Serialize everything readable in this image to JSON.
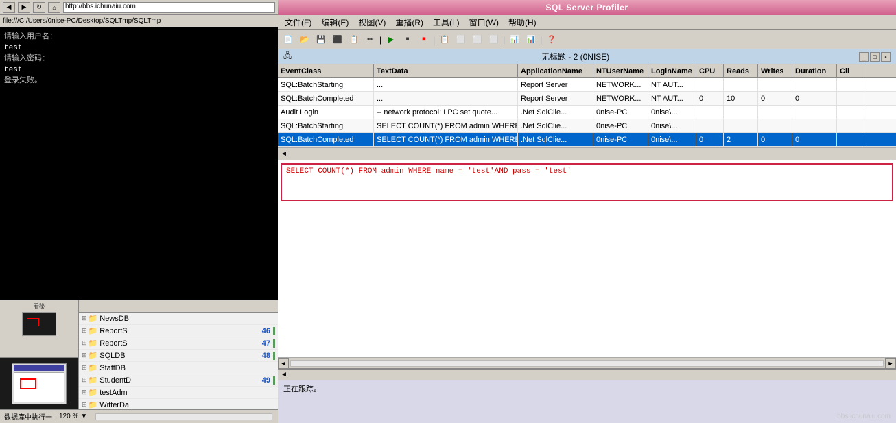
{
  "app": {
    "title": "SQL Server Profiler",
    "window_title": "无标题 - 2 (0NISE)"
  },
  "browser": {
    "url": "http://bbs.ichunaiu.com",
    "path": "file:///C:/Users/0nise-PC/Desktop/SQLTmp/SQLTmp",
    "back_btn": "◀",
    "forward_btn": "▶",
    "refresh_btn": "↻",
    "home_btn": "⌂"
  },
  "terminal": {
    "lines": [
      {
        "text": "请输入用户名：",
        "type": "prompt"
      },
      {
        "text": "test",
        "type": "input"
      },
      {
        "text": "请输入密码：",
        "type": "prompt"
      },
      {
        "text": "test",
        "type": "input"
      },
      {
        "text": "登录失败。",
        "type": "error"
      }
    ]
  },
  "menu": {
    "items": [
      {
        "label": "文件(F)"
      },
      {
        "label": "编辑(E)"
      },
      {
        "label": "视图(V)"
      },
      {
        "label": "重播(R)"
      },
      {
        "label": "工具(L)"
      },
      {
        "label": "窗口(W)"
      },
      {
        "label": "帮助(H)"
      }
    ]
  },
  "table": {
    "headers": [
      "EventClass",
      "TextData",
      "ApplicationName",
      "NTUserName",
      "LoginName",
      "CPU",
      "Reads",
      "Writes",
      "Duration",
      "Cli"
    ],
    "rows": [
      {
        "event": "SQL:BatchStarting",
        "textdata": "...",
        "appname": "Report Server",
        "ntuser": "NETWORK...",
        "login": "NT AUT...",
        "cpu": "",
        "reads": "",
        "writes": "",
        "duration": "",
        "cli": "",
        "selected": false
      },
      {
        "event": "SQL:BatchCompleted",
        "textdata": "...",
        "appname": "Report Server",
        "ntuser": "NETWORK...",
        "login": "NT AUT...",
        "cpu": "0",
        "reads": "10",
        "writes": "0",
        "duration": "0",
        "cli": "",
        "selected": false
      },
      {
        "event": "Audit Login",
        "textdata": "-- network protocol: LPC  set quote...",
        "appname": ".Net SqlClie...",
        "ntuser": "0nise-PC",
        "login": "0nise\\...",
        "cpu": "",
        "reads": "",
        "writes": "",
        "duration": "",
        "cli": "",
        "selected": false
      },
      {
        "event": "SQL:BatchStarting",
        "textdata": "SELECT COUNT(*) FROM admin WHERE na...",
        "appname": ".Net SqlClie...",
        "ntuser": "0nise-PC",
        "login": "0nise\\...",
        "cpu": "",
        "reads": "",
        "writes": "",
        "duration": "",
        "cli": "",
        "selected": false
      },
      {
        "event": "SQL:BatchCompleted",
        "textdata": "SELECT COUNT(*) FROM admin WHERE na...",
        "appname": ".Net SqlClie...",
        "ntuser": "0nise-PC",
        "login": "0nise\\...",
        "cpu": "0",
        "reads": "2",
        "writes": "0",
        "duration": "0",
        "cli": "",
        "selected": true
      }
    ]
  },
  "sql_detail": {
    "text": "SELECT COUNT(*) FROM admin WHERE name = 'test'AND pass = 'test'"
  },
  "status": {
    "text": "正在跟踪。"
  },
  "db_list": {
    "items": [
      {
        "name": "NewsDB",
        "number": ""
      },
      {
        "name": "ReportS",
        "number": "46"
      },
      {
        "name": "ReportS",
        "number": "47"
      },
      {
        "name": "SQLDB",
        "number": "48"
      },
      {
        "name": "StaffDB",
        "number": ""
      },
      {
        "name": "StudentD",
        "number": "49"
      },
      {
        "name": "testAdm",
        "number": ""
      },
      {
        "name": "WitterDa",
        "number": ""
      }
    ]
  },
  "profiler_status": {
    "text": "数据库中执行一",
    "zoom": "120 %"
  },
  "toolbar": {
    "buttons": [
      "📂",
      "💾",
      "⬛",
      "📋",
      "✏",
      "🔲",
      "▶",
      "⏸",
      "⏹",
      "📋",
      "⬛",
      "⬛",
      "⬛",
      "📊",
      "📊",
      "❓"
    ]
  },
  "watermark": "bbs.ichunaiu.com"
}
